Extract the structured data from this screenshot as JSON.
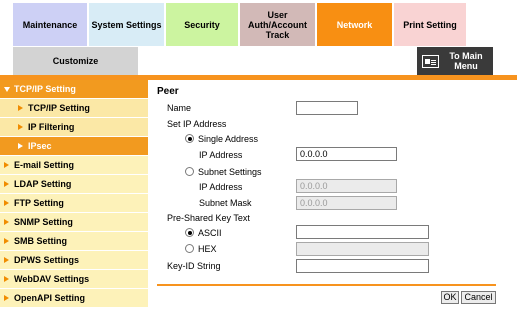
{
  "tabs": {
    "maintenance": "Maintenance",
    "system_settings": "System Settings",
    "security": "Security",
    "user_auth": [
      "User",
      "Auth/Account",
      "Track"
    ],
    "network": "Network",
    "print_setting": "Print Setting",
    "customize": "Customize"
  },
  "main_menu": {
    "label_line1": "To Main",
    "label_line2": "Menu",
    "icon": "main-menu-icon"
  },
  "sidebar": {
    "items": [
      {
        "label": "TCP/IP Setting",
        "state": "expanded"
      },
      {
        "label": "TCP/IP Setting",
        "state": "sub"
      },
      {
        "label": "IP Filtering",
        "state": "sub"
      },
      {
        "label": "IPsec",
        "state": "selected"
      },
      {
        "label": "E-mail Setting"
      },
      {
        "label": "LDAP Setting"
      },
      {
        "label": "FTP Setting"
      },
      {
        "label": "SNMP Setting"
      },
      {
        "label": "SMB Setting"
      },
      {
        "label": "DPWS Settings"
      },
      {
        "label": "WebDAV Settings"
      },
      {
        "label": "OpenAPI Setting"
      }
    ]
  },
  "form": {
    "title": "Peer",
    "name_label": "Name",
    "name_value": "",
    "set_ip_label": "Set IP Address",
    "single_address_label": "Single Address",
    "single_ip_label": "IP Address",
    "single_ip_value": "0.0.0.0",
    "subnet_settings_label": "Subnet Settings",
    "subnet_ip_label": "IP Address",
    "subnet_ip_value": "0.0.0.0",
    "subnet_mask_label": "Subnet Mask",
    "subnet_mask_value": "0.0.0.0",
    "psk_label": "Pre-Shared Key Text",
    "ascii_label": "ASCII",
    "ascii_value": "",
    "hex_label": "HEX",
    "hex_value": "",
    "keyid_label": "Key-ID String",
    "keyid_value": "",
    "selected_ip_mode": "single",
    "selected_key_mode": "ascii"
  },
  "buttons": {
    "ok": "OK",
    "cancel": "Cancel"
  },
  "colors": {
    "accent": "#f7931e",
    "network_tab": "#f88f12"
  }
}
